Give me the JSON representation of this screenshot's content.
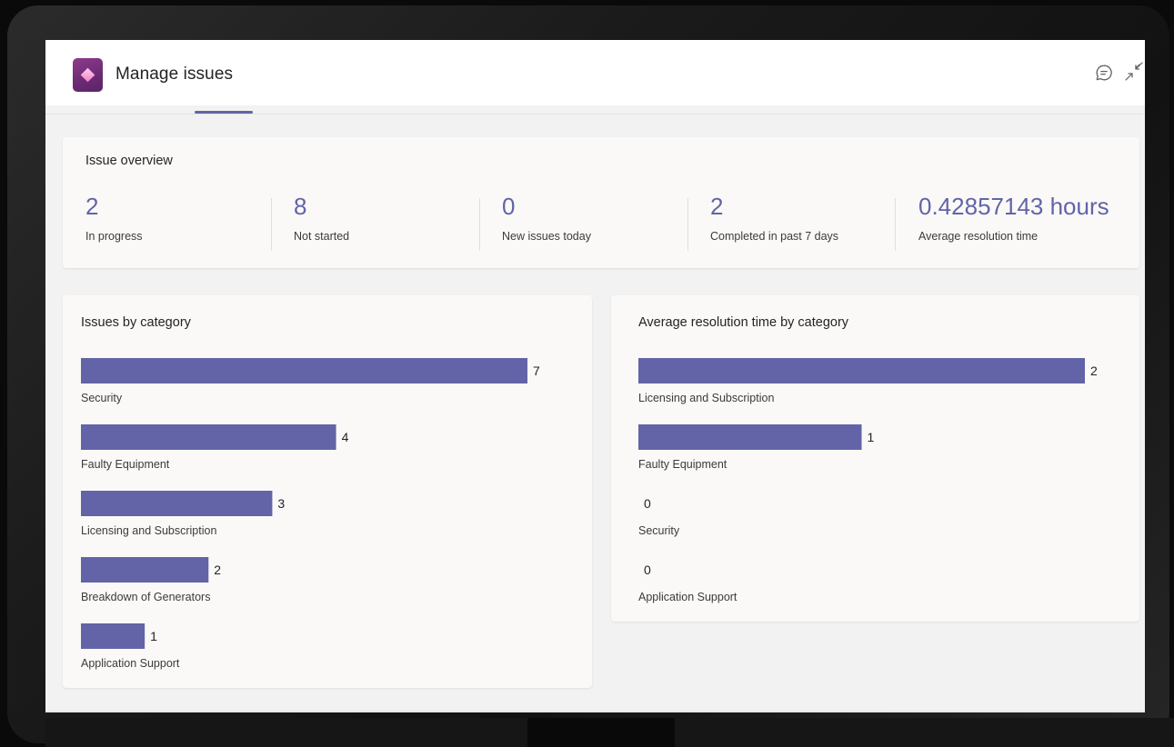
{
  "app": {
    "title": "Manage issues"
  },
  "icons": {
    "chat": "chat-bubble-icon",
    "collapse": "collapse-arrows-icon"
  },
  "colors": {
    "accent": "#6264a7",
    "bar": "#6264a7"
  },
  "overview": {
    "title": "Issue overview",
    "kpis": [
      {
        "value": "2",
        "label": "In progress"
      },
      {
        "value": "8",
        "label": "Not started"
      },
      {
        "value": "0",
        "label": "New issues today"
      },
      {
        "value": "2",
        "label": "Completed in past 7 days"
      },
      {
        "value": "0.42857143 hours",
        "label": "Average resolution time"
      }
    ]
  },
  "chart_data": [
    {
      "type": "bar",
      "orientation": "horizontal",
      "title": "Issues by category",
      "categories": [
        "Security",
        "Faulty Equipment",
        "Licensing and Subscription",
        "Breakdown of Generators",
        "Application Support"
      ],
      "values": [
        7,
        4,
        3,
        2,
        1
      ],
      "xlim": [
        0,
        7
      ]
    },
    {
      "type": "bar",
      "orientation": "horizontal",
      "title": "Average resolution time by category",
      "categories": [
        "Licensing and Subscription",
        "Faulty Equipment",
        "Security",
        "Application Support"
      ],
      "values": [
        2,
        1,
        0,
        0
      ],
      "xlim": [
        0,
        2
      ]
    }
  ]
}
